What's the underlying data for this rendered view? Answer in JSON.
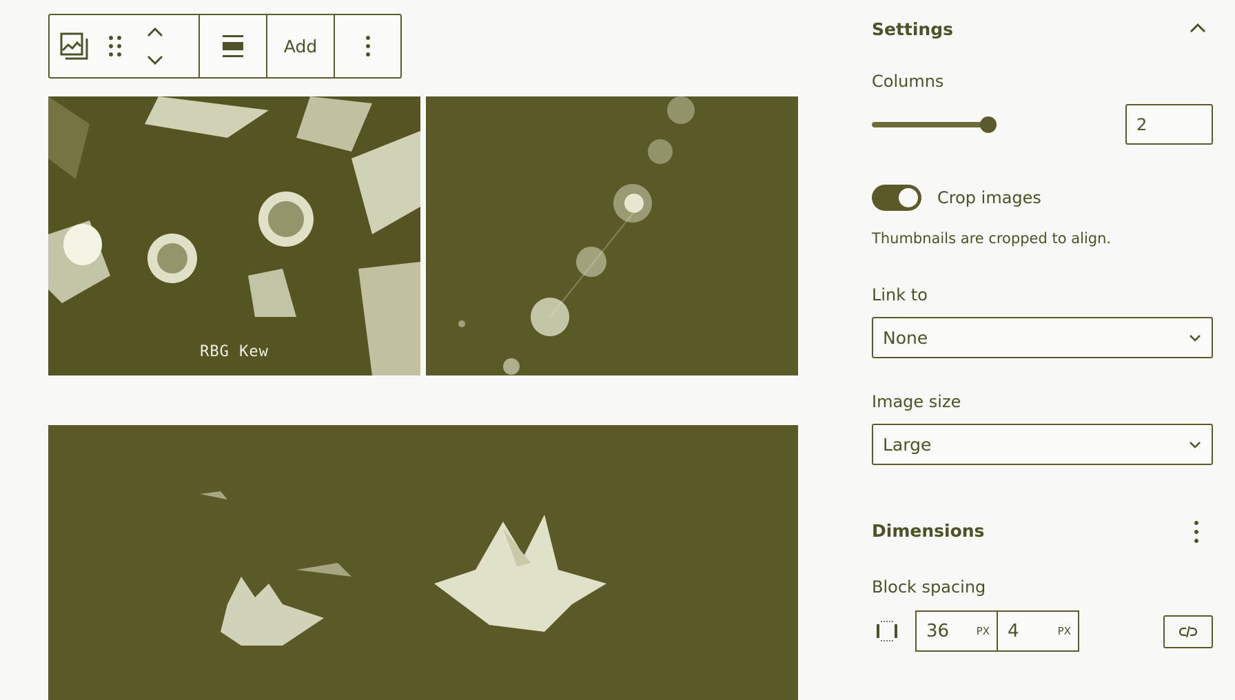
{
  "toolbar": {
    "add_label": "Add",
    "icons": [
      "gallery-icon",
      "drag-handle-icon",
      "move-up-icon",
      "move-down-icon",
      "align-icon",
      "more-options-icon"
    ]
  },
  "gallery": {
    "images": [
      {
        "name": "flowers-image",
        "caption": "RBG Kew"
      },
      {
        "name": "flower-spikes-image",
        "caption": ""
      },
      {
        "name": "water-lily-image",
        "caption": ""
      }
    ]
  },
  "settings": {
    "title": "Settings",
    "columns_label": "Columns",
    "columns_value": "2",
    "columns_slider_fraction": 1.0,
    "crop_label": "Crop images",
    "crop_enabled": true,
    "crop_help": "Thumbnails are cropped to align.",
    "link_label": "Link to",
    "link_value": "None",
    "size_label": "Image size",
    "size_value": "Large"
  },
  "dimensions": {
    "title": "Dimensions",
    "block_spacing_label": "Block spacing",
    "horizontal_value": "36",
    "horizontal_unit": "PX",
    "vertical_value": "4",
    "vertical_unit": "PX"
  },
  "colors": {
    "accent": "#5a5a28",
    "text": "#4f5228",
    "background": "#f8f8f6"
  }
}
